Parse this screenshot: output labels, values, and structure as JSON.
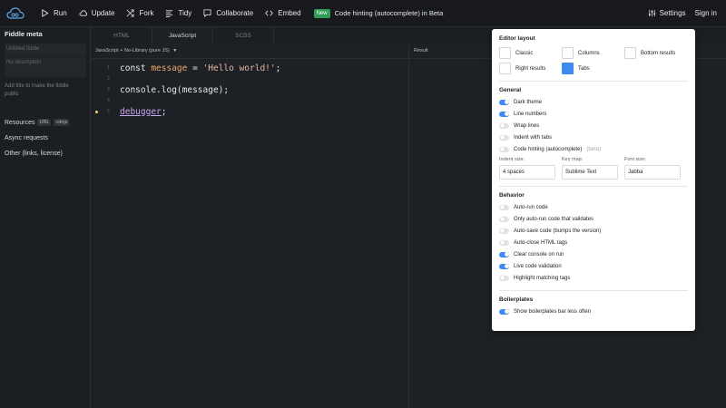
{
  "toolbar": {
    "run": "Run",
    "update": "Update",
    "fork": "Fork",
    "tidy": "Tidy",
    "collaborate": "Collaborate",
    "embed": "Embed",
    "new_badge": "New",
    "news": "Code hinting (autocomplete) in Beta",
    "settings": "Settings",
    "signin": "Sign in"
  },
  "sidebar": {
    "title": "Fiddle meta",
    "title_placeholder": "Untitled fiddle",
    "description_placeholder": "No description",
    "hint": "Add title to make the fiddle public",
    "resources": "Resources",
    "resource_tags": [
      "URL",
      "cdnjs"
    ],
    "async": "Async requests",
    "other": "Other (links, license)"
  },
  "tabs": [
    "HTML",
    "JavaScript",
    "SCSS"
  ],
  "editor": {
    "header": "JavaScript + No-Library (pure JS)",
    "line_numbers": [
      "1",
      "2",
      "3",
      "4",
      "5"
    ],
    "line1_kw": "const ",
    "line1_var": "message",
    "line1_eq": " = ",
    "line1_str": "'Hello world!'",
    "line1_end": ";",
    "line3": "console.log(message);",
    "line5_dbg": "debugger",
    "line5_end": ";"
  },
  "result": {
    "header": "Result"
  },
  "settings": {
    "layout_title": "Editor layout",
    "layouts": [
      "Classic",
      "Columns",
      "Bottom results",
      "Right results",
      "Tabs"
    ],
    "general_title": "General",
    "general": [
      "Dark theme",
      "Line numbers",
      "Wrap lines",
      "Indent with tabs",
      "Code hinting (autocomplete)"
    ],
    "beta": "(beta)",
    "indent_label": "Indent size:",
    "indent_value": "4 spaces",
    "keymap_label": "Key map:",
    "keymap_value": "Sublime Text",
    "font_label": "Font size:",
    "font_value": "Jabba",
    "behavior_title": "Behavior",
    "behavior": [
      "Auto-run code",
      "Only auto-run code that validates",
      "Auto-save code (bumps the version)",
      "Auto-close HTML tags",
      "Clear console on run",
      "Live code validation",
      "Highlight matching tags"
    ],
    "boilerplates_title": "Boilerplates",
    "boilerplates": [
      "Show boilerplates bar less often"
    ]
  },
  "colors": {
    "accent": "#3d8bf0",
    "new_badge": "#2e9e55"
  }
}
